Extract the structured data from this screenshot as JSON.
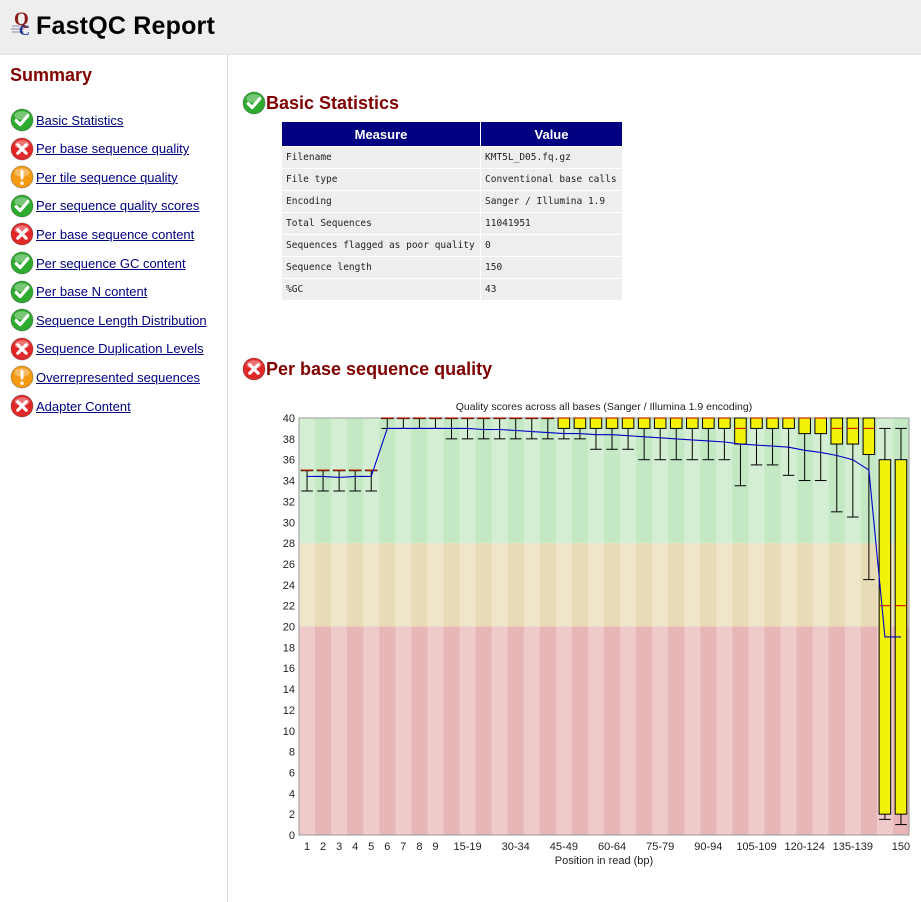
{
  "header": {
    "title": "FastQC Report"
  },
  "sidebar": {
    "title": "Summary",
    "items": [
      {
        "label": "Basic Statistics",
        "status": "pass"
      },
      {
        "label": "Per base sequence quality",
        "status": "fail"
      },
      {
        "label": "Per tile sequence quality",
        "status": "warn"
      },
      {
        "label": "Per sequence quality scores",
        "status": "pass"
      },
      {
        "label": "Per base sequence content",
        "status": "fail"
      },
      {
        "label": "Per sequence GC content",
        "status": "pass"
      },
      {
        "label": "Per base N content",
        "status": "pass"
      },
      {
        "label": "Sequence Length Distribution",
        "status": "pass"
      },
      {
        "label": "Sequence Duplication Levels",
        "status": "fail"
      },
      {
        "label": "Overrepresented sequences",
        "status": "warn"
      },
      {
        "label": "Adapter Content",
        "status": "fail"
      }
    ]
  },
  "basic_stats": {
    "title": "Basic Statistics",
    "status": "pass",
    "headers": {
      "measure": "Measure",
      "value": "Value"
    },
    "rows": [
      {
        "measure": "Filename",
        "value": "KMT5L_D05.fq.gz"
      },
      {
        "measure": "File type",
        "value": "Conventional base calls"
      },
      {
        "measure": "Encoding",
        "value": "Sanger / Illumina 1.9"
      },
      {
        "measure": "Total Sequences",
        "value": "11041951"
      },
      {
        "measure": "Sequences flagged as poor quality",
        "value": "0"
      },
      {
        "measure": "Sequence length",
        "value": "150"
      },
      {
        "measure": "%GC",
        "value": "43"
      }
    ]
  },
  "per_base_quality": {
    "title": "Per base sequence quality",
    "status": "fail"
  },
  "colors": {
    "pass": "#2eaa2e",
    "fail": "#e02828",
    "warn": "#f59a12",
    "header_bg": "#eeeeee",
    "table_head": "#000080",
    "section_title": "#800000",
    "zone_good": "#c4e8c4",
    "zone_warn": "#e8dcb6",
    "zone_bad": "#e8b6b6",
    "box_fill": "#f2f20a",
    "median": "#cc2200",
    "mean_line": "#0000c8"
  },
  "chart_data": {
    "type": "box",
    "title": "Quality scores across all bases (Sanger / Illumina 1.9 encoding)",
    "xlabel": "Position in read (bp)",
    "ylabel": "",
    "ylim": [
      0,
      40
    ],
    "yticks": [
      0,
      2,
      4,
      6,
      8,
      10,
      12,
      14,
      16,
      18,
      20,
      22,
      24,
      26,
      28,
      30,
      32,
      34,
      36,
      38,
      40
    ],
    "zones": [
      {
        "from": 28,
        "to": 40,
        "level": "good"
      },
      {
        "from": 20,
        "to": 28,
        "level": "warn"
      },
      {
        "from": 0,
        "to": 20,
        "level": "bad"
      }
    ],
    "categories": [
      "1",
      "2",
      "3",
      "4",
      "5",
      "6",
      "7",
      "8",
      "9",
      "10-14",
      "15-19",
      "20-24",
      "25-29",
      "30-34",
      "35-39",
      "40-44",
      "45-49",
      "50-54",
      "55-59",
      "60-64",
      "65-69",
      "70-74",
      "75-79",
      "80-84",
      "85-89",
      "90-94",
      "95-99",
      "100-104",
      "105-109",
      "110-114",
      "115-119",
      "120-124",
      "125-129",
      "130-134",
      "135-139",
      "140-144",
      "145-149",
      "150"
    ],
    "shown_tick_labels": [
      "1",
      "2",
      "3",
      "4",
      "5",
      "6",
      "7",
      "8",
      "9",
      "15-19",
      "30-34",
      "45-49",
      "60-64",
      "75-79",
      "90-94",
      "105-109",
      "120-124",
      "135-139",
      "150"
    ],
    "series": [
      {
        "name": "q10",
        "values": [
          33,
          33,
          33,
          33,
          33,
          39,
          39,
          39,
          39,
          38,
          38,
          38,
          38,
          38,
          38,
          38,
          38,
          38,
          37,
          37,
          37,
          36,
          36,
          36,
          36,
          36,
          36,
          33.5,
          35.5,
          35.5,
          34.5,
          34,
          34,
          31,
          30.5,
          24.5,
          1.5,
          1
        ]
      },
      {
        "name": "q25",
        "values": [
          35,
          35,
          35,
          35,
          35,
          40,
          40,
          40,
          40,
          40,
          40,
          40,
          40,
          40,
          40,
          40,
          39,
          39,
          39,
          39,
          39,
          39,
          39,
          39,
          39,
          39,
          39,
          37.5,
          39,
          39,
          39,
          38.5,
          38.5,
          37.5,
          37.5,
          36.5,
          2,
          2
        ]
      },
      {
        "name": "median",
        "values": [
          35,
          35,
          35,
          35,
          35,
          40,
          40,
          40,
          40,
          40,
          40,
          40,
          40,
          40,
          40,
          40,
          40,
          40,
          40,
          40,
          40,
          40,
          40,
          40,
          40,
          40,
          40,
          39,
          40,
          40,
          40,
          40,
          40,
          39,
          39,
          39,
          22,
          22
        ]
      },
      {
        "name": "q75",
        "values": [
          35,
          35,
          35,
          35,
          35,
          40,
          40,
          40,
          40,
          40,
          40,
          40,
          40,
          40,
          40,
          40,
          40,
          40,
          40,
          40,
          40,
          40,
          40,
          40,
          40,
          40,
          40,
          40,
          40,
          40,
          40,
          40,
          40,
          40,
          40,
          40,
          36,
          36
        ]
      },
      {
        "name": "q90",
        "values": [
          35,
          35,
          35,
          35,
          35,
          40,
          40,
          40,
          40,
          40,
          40,
          40,
          40,
          40,
          40,
          40,
          40,
          40,
          40,
          40,
          40,
          40,
          40,
          40,
          40,
          40,
          40,
          40,
          40,
          40,
          40,
          40,
          40,
          40,
          40,
          40,
          39,
          39
        ]
      },
      {
        "name": "mean",
        "values": [
          34.4,
          34.4,
          34.3,
          34.4,
          34.4,
          39.0,
          39.0,
          39.0,
          39.0,
          39.0,
          39.0,
          38.9,
          38.9,
          38.8,
          38.7,
          38.6,
          38.5,
          38.5,
          38.4,
          38.4,
          38.3,
          38.2,
          38.1,
          38.0,
          37.9,
          37.8,
          37.7,
          37.5,
          37.4,
          37.3,
          37.2,
          36.9,
          36.7,
          36.4,
          36.0,
          35.0,
          19.0,
          19.0
        ]
      }
    ]
  }
}
